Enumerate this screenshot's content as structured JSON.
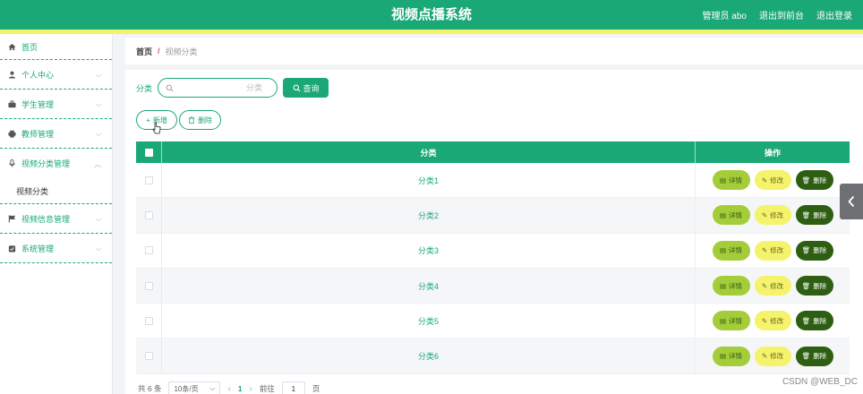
{
  "header": {
    "title": "视频点播系统",
    "admin_label": "管理员 abo",
    "back_to_front": "退出到前台",
    "logout": "退出登录"
  },
  "sidebar": {
    "items": [
      {
        "label": "首页",
        "icon": "home-icon"
      },
      {
        "label": "个人中心",
        "icon": "user-icon"
      },
      {
        "label": "学生管理",
        "icon": "briefcase-icon"
      },
      {
        "label": "教师管理",
        "icon": "printer-icon"
      },
      {
        "label": "视频分类管理",
        "icon": "mic-icon",
        "expanded": true
      },
      {
        "label": "视频信息管理",
        "icon": "flag-icon"
      },
      {
        "label": "系统管理",
        "icon": "clipboard-icon"
      }
    ],
    "submenu": [
      "视频分类"
    ]
  },
  "breadcrumb": {
    "home": "首页",
    "separator": "/",
    "current": "视频分类"
  },
  "search": {
    "label": "分类",
    "placeholder": "分类",
    "button": "查询"
  },
  "actions": {
    "add": "新增",
    "delete": "删除"
  },
  "table": {
    "headers": {
      "category": "分类",
      "operations": "操作"
    },
    "rows": [
      {
        "category": "分类1"
      },
      {
        "category": "分类2"
      },
      {
        "category": "分类3"
      },
      {
        "category": "分类4"
      },
      {
        "category": "分类5"
      },
      {
        "category": "分类6"
      }
    ],
    "ops": {
      "detail": "详情",
      "edit": "修改",
      "remove": "删除"
    }
  },
  "pagination": {
    "total": "共 6 条",
    "page_size": "10条/页",
    "current_page": "1",
    "goto_label": "前往",
    "goto_value": "1",
    "page_unit": "页"
  },
  "watermark": "CSDN @WEB_DC",
  "colors": {
    "primary": "#1aa876",
    "accent_yellow": "#f4f36b",
    "detail_green": "#a5cd39",
    "delete_dark": "#2d5e11"
  }
}
